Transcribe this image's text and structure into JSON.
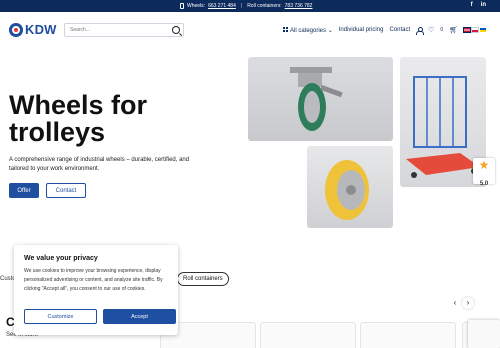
{
  "topbar": {
    "wheels_label": "Wheels:",
    "wheels_phone": "663 271 484",
    "separator": "|",
    "roll_label": "Roll containers:",
    "roll_phone": "783 736 782",
    "facebook": "f",
    "linkedin": "in"
  },
  "header": {
    "logo_text": "KDW",
    "search_placeholder": "Search...",
    "nav": {
      "all_categories": "All categories",
      "individual_pricing": "Individual pricing",
      "contact": "Contact",
      "wishlist_count": "0"
    }
  },
  "hero": {
    "title": "Wheels for trolleys",
    "description": "A comprehensive range of industrial wheels – durable, certified, and tailored to your work environment.",
    "offer_button": "Offer",
    "contact_button": "Contact"
  },
  "rating": {
    "value": "5.0"
  },
  "categories": {
    "left_text": "Custo",
    "chip_label": "Roll containers",
    "section_heading": "Ca",
    "section_link": "See in store"
  },
  "cookie": {
    "title": "We value your privacy",
    "text": "We use cookies to improve your browsing experience, display personalized advertising or content, and analyze site traffic. By clicking \"Accept all\", you consent to our use of cookies.",
    "customize_button": "Customize",
    "accept_button": "Accept"
  },
  "colors": {
    "brand": "#1f4fa0",
    "topbar": "#0d2a5c",
    "star": "#f5a623"
  },
  "icons": [
    "phone-icon",
    "facebook-icon",
    "linkedin-icon",
    "search-icon",
    "grid-icon",
    "chevron-down-icon",
    "user-icon",
    "heart-icon",
    "cart-icon",
    "star-icon",
    "chevron-left-icon",
    "chevron-right-icon"
  ]
}
